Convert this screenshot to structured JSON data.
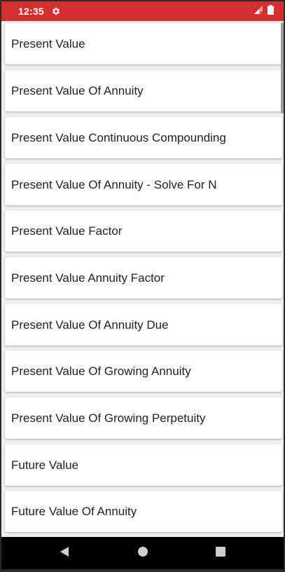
{
  "status_bar": {
    "time": "12:35",
    "color": "#d32f2f",
    "icons": [
      "gear-icon",
      "signal-icon",
      "battery-icon"
    ]
  },
  "list": {
    "items": [
      {
        "label": "Present Value"
      },
      {
        "label": "Present Value Of Annuity"
      },
      {
        "label": "Present Value Continuous Compounding"
      },
      {
        "label": "Present Value Of Annuity - Solve For N"
      },
      {
        "label": "Present Value Factor"
      },
      {
        "label": "Present Value Annuity Factor"
      },
      {
        "label": "Present Value Of Annuity Due"
      },
      {
        "label": "Present Value Of Growing Annuity"
      },
      {
        "label": "Present Value Of Growing Perpetuity"
      },
      {
        "label": "Future Value"
      },
      {
        "label": "Future Value Of Annuity"
      }
    ]
  },
  "nav_bar": {
    "buttons": [
      "back-icon",
      "home-icon",
      "recents-icon"
    ]
  }
}
